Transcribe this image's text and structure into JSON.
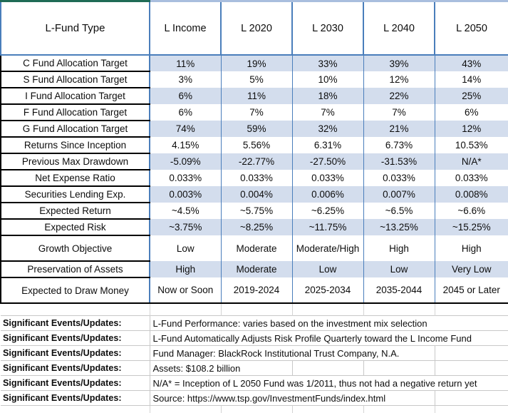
{
  "colors": {
    "accent_green": "#1F6B55",
    "accent_blue": "#4A7EBB",
    "row_shade": "#D3DDED",
    "grid_gray": "#C8C8C8",
    "text": "#0D0D0D"
  },
  "table": {
    "header": {
      "label_column": "L-Fund Type",
      "columns": [
        "L Income",
        "L 2020",
        "L 2030",
        "L 2040",
        "L 2050"
      ]
    },
    "rows": [
      {
        "label": "C Fund Allocation Target",
        "shaded": true,
        "tall": false,
        "values": [
          "11%",
          "19%",
          "33%",
          "39%",
          "43%"
        ]
      },
      {
        "label": "S Fund Allocation Target",
        "shaded": false,
        "tall": false,
        "values": [
          "3%",
          "5%",
          "10%",
          "12%",
          "14%"
        ]
      },
      {
        "label": "I Fund Allocation Target",
        "shaded": true,
        "tall": false,
        "values": [
          "6%",
          "11%",
          "18%",
          "22%",
          "25%"
        ]
      },
      {
        "label": "F Fund Allocation Target",
        "shaded": false,
        "tall": false,
        "values": [
          "6%",
          "7%",
          "7%",
          "7%",
          "6%"
        ]
      },
      {
        "label": "G Fund Allocation Target",
        "shaded": true,
        "tall": false,
        "values": [
          "74%",
          "59%",
          "32%",
          "21%",
          "12%"
        ]
      },
      {
        "label": "Returns Since Inception",
        "shaded": false,
        "tall": false,
        "values": [
          "4.15%",
          "5.56%",
          "6.31%",
          "6.73%",
          "10.53%"
        ]
      },
      {
        "label": "Previous Max Drawdown",
        "shaded": true,
        "tall": false,
        "values": [
          "-5.09%",
          "-22.77%",
          "-27.50%",
          "-31.53%",
          "N/A*"
        ]
      },
      {
        "label": "Net Expense Ratio",
        "shaded": false,
        "tall": false,
        "values": [
          "0.033%",
          "0.033%",
          "0.033%",
          "0.033%",
          "0.033%"
        ]
      },
      {
        "label": "Securities Lending Exp.",
        "shaded": true,
        "tall": false,
        "values": [
          "0.003%",
          "0.004%",
          "0.006%",
          "0.007%",
          "0.008%"
        ]
      },
      {
        "label": "Expected Return",
        "shaded": false,
        "tall": false,
        "values": [
          "~4.5%",
          "~5.75%",
          "~6.25%",
          "~6.5%",
          "~6.6%"
        ]
      },
      {
        "label": "Expected Risk",
        "shaded": true,
        "tall": false,
        "values": [
          "~3.75%",
          "~8.25%",
          "~11.75%",
          "~13.25%",
          "~15.25%"
        ]
      },
      {
        "label": "Growth Objective",
        "shaded": false,
        "tall": true,
        "values": [
          "Low",
          "Moderate",
          "Moderate/High",
          "High",
          "High"
        ]
      },
      {
        "label": "Preservation of Assets",
        "shaded": true,
        "tall": false,
        "values": [
          "High",
          "Moderate",
          "Low",
          "Low",
          "Very Low"
        ]
      },
      {
        "label": "Expected to Draw Money",
        "shaded": false,
        "tall": true,
        "values": [
          "Now or Soon",
          "2019-2024",
          "2025-2034",
          "2035-2044",
          "2045 or Later"
        ]
      }
    ]
  },
  "notes": {
    "label": "Significant Events/Updates:",
    "items": [
      {
        "text": "L-Fund Performance: varies based on the investment mix selection",
        "span": 5
      },
      {
        "text": "L-Fund Automatically Adjusts Risk Profile Quarterly toward the L Income Fund",
        "span": 5
      },
      {
        "text": "Fund Manager: BlackRock Institutional Trust Company, N.A.",
        "span": 4
      },
      {
        "text": "Assets: $108.2 billion",
        "span": 2
      },
      {
        "text": "N/A* = Inception of L 2050 Fund was 1/2011, thus not had a negative return yet",
        "span": 5
      },
      {
        "text": "Source: https://www.tsp.gov/InvestmentFunds/index.html",
        "span": 4
      }
    ]
  }
}
